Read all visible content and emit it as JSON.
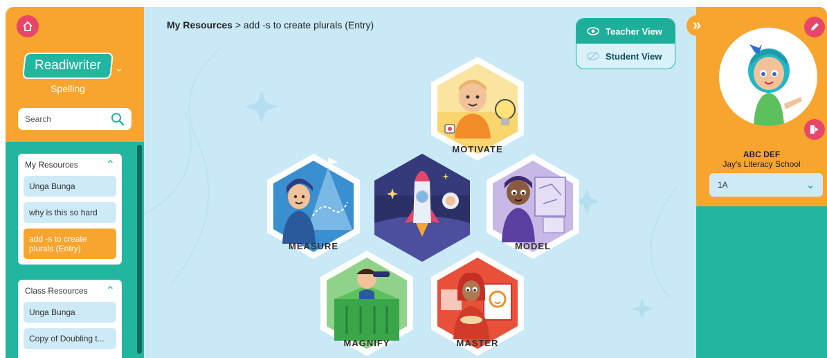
{
  "sidebar": {
    "logo_text": "Readiwriter",
    "subtitle": "Spelling",
    "search_placeholder": "Search",
    "groups": [
      {
        "title": "My Resources",
        "items": [
          {
            "label": "Unga Bunga"
          },
          {
            "label": "why is this so hard"
          },
          {
            "label": "add -s to create plurals (Entry)"
          }
        ]
      },
      {
        "title": "Class Resources",
        "items": [
          {
            "label": "Unga Bunga"
          },
          {
            "label": "Copy of Doubling t..."
          }
        ]
      }
    ]
  },
  "breadcrumb": {
    "root": "My Resources",
    "separator": ">",
    "current": "add -s to create plurals (Entry)"
  },
  "view_toggle": {
    "teacher_label": "Teacher View",
    "student_label": "Student View",
    "selected": "Teacher View"
  },
  "activities": {
    "motivate": "MOTIVATE",
    "measure": "MEASURE",
    "model": "MODEL",
    "magnify": "MAGNIFY",
    "master": "MASTER"
  },
  "profile": {
    "name": "ABC DEF",
    "school": "Jay's Literacy School",
    "class_selected": "1A"
  },
  "colors": {
    "orange": "#f7a52f",
    "teal": "#22b6a0",
    "pink": "#e7466a",
    "canvas": "#c9e9f7"
  }
}
